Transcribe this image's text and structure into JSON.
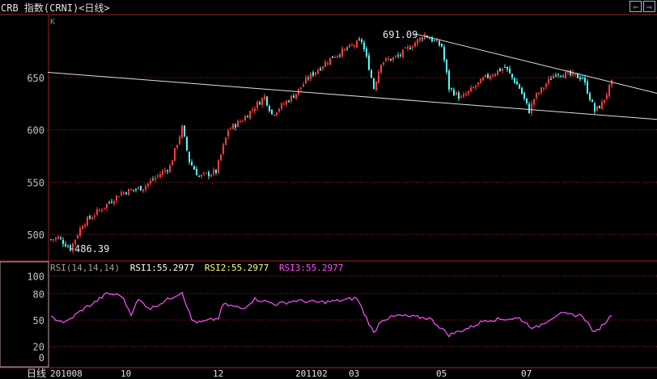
{
  "window": {
    "title": "CRB 指数(CRNI)<日线>",
    "prev_icon": "arrow-left-icon",
    "next_icon": "arrow-right-icon",
    "prev_glyph": "⇦",
    "next_glyph": "⇨"
  },
  "main_panel": {
    "label": "K",
    "max_label": "691.09",
    "min_label": "486.39"
  },
  "rsi_panel": {
    "label": "RSI(14,14,14)",
    "rsi1": "RSI1:55.2977",
    "rsi2": "RSI2:55.2977",
    "rsi3": "RSI3:55.2977"
  },
  "x_axis": {
    "period_label": "日线"
  },
  "colors": {
    "up": "#ff3c3c",
    "down": "#54fcfc",
    "grid": "#a01818",
    "frame": "#a02020",
    "rsi": "#ff50ff",
    "trend": "#e0e0e0",
    "axis_text": "#c0c0c0"
  },
  "chart_data": [
    {
      "type": "candlestick",
      "title": "CRB 指数(CRNI) 日线",
      "y_ticks": [
        500,
        550,
        600,
        650
      ],
      "y_tick_labels": [
        "500",
        "550",
        "600",
        "650"
      ],
      "ylim": [
        480,
        700
      ],
      "candle_count": 232,
      "x_ticks": [
        {
          "index": 0,
          "label": "201008"
        },
        {
          "index": 29,
          "label": "10"
        },
        {
          "index": 67,
          "label": "12"
        },
        {
          "index": 101,
          "label": "201102"
        },
        {
          "index": 123,
          "label": "03"
        },
        {
          "index": 159,
          "label": "05"
        },
        {
          "index": 194,
          "label": "07"
        }
      ],
      "close_keypoints": [
        [
          0,
          495
        ],
        [
          3,
          497
        ],
        [
          8,
          486.39
        ],
        [
          13,
          510
        ],
        [
          29,
          540
        ],
        [
          38,
          545
        ],
        [
          49,
          565
        ],
        [
          54,
          602
        ],
        [
          57,
          570
        ],
        [
          61,
          555
        ],
        [
          68,
          560
        ],
        [
          73,
          600
        ],
        [
          79,
          610
        ],
        [
          88,
          632
        ],
        [
          91,
          615
        ],
        [
          101,
          635
        ],
        [
          106,
          650
        ],
        [
          116,
          670
        ],
        [
          128,
          685
        ],
        [
          131,
          660
        ],
        [
          133,
          640
        ],
        [
          136,
          665
        ],
        [
          143,
          670
        ],
        [
          154,
          691.09
        ],
        [
          161,
          680
        ],
        [
          164,
          640
        ],
        [
          169,
          630
        ],
        [
          179,
          650
        ],
        [
          187,
          660
        ],
        [
          193,
          640
        ],
        [
          197,
          618
        ],
        [
          199,
          630
        ],
        [
          208,
          655
        ],
        [
          219,
          650
        ],
        [
          224,
          618
        ],
        [
          227,
          625
        ],
        [
          231,
          645
        ]
      ],
      "max": {
        "index": 152,
        "value": 691.09
      },
      "min": {
        "index": 8,
        "value": 486.39
      },
      "trendlines": [
        {
          "name": "upper",
          "from": [
            150,
            692
          ],
          "to": [
            250,
            635
          ]
        },
        {
          "name": "lower",
          "from": [
            -1,
            655
          ],
          "to": [
            250,
            610
          ]
        }
      ]
    },
    {
      "type": "line",
      "title": "RSI(14,14,14)",
      "y_ticks": [
        0,
        20,
        50,
        80,
        100
      ],
      "y_tick_labels": [
        "0",
        "20",
        "50",
        "80",
        "100"
      ],
      "ylim": [
        0,
        100
      ],
      "last_value": 55.2977,
      "keypoints": [
        [
          0,
          53
        ],
        [
          6,
          47
        ],
        [
          13,
          62
        ],
        [
          18,
          70
        ],
        [
          23,
          80
        ],
        [
          29,
          78
        ],
        [
          33,
          57
        ],
        [
          36,
          73
        ],
        [
          41,
          63
        ],
        [
          54,
          82
        ],
        [
          58,
          50
        ],
        [
          61,
          47
        ],
        [
          69,
          52
        ],
        [
          71,
          68
        ],
        [
          79,
          63
        ],
        [
          84,
          74
        ],
        [
          93,
          68
        ],
        [
          101,
          72
        ],
        [
          111,
          70
        ],
        [
          119,
          72
        ],
        [
          126,
          75
        ],
        [
          133,
          35
        ],
        [
          136,
          50
        ],
        [
          143,
          55
        ],
        [
          156,
          52
        ],
        [
          164,
          33
        ],
        [
          173,
          42
        ],
        [
          179,
          50
        ],
        [
          193,
          52
        ],
        [
          199,
          40
        ],
        [
          209,
          57
        ],
        [
          219,
          55
        ],
        [
          224,
          35
        ],
        [
          231,
          55.2977
        ]
      ]
    }
  ]
}
